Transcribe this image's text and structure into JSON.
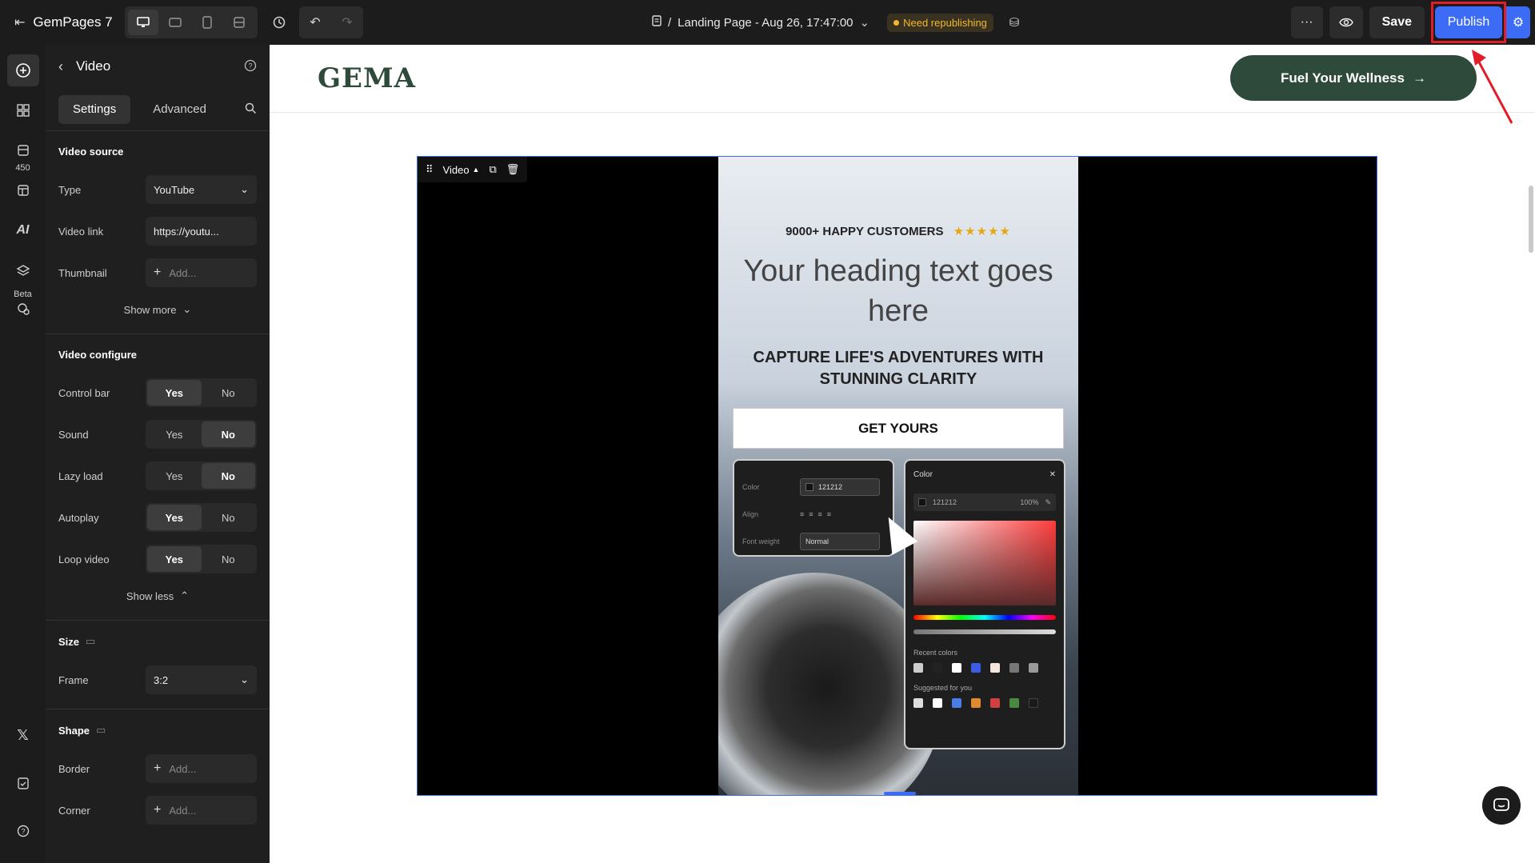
{
  "app": {
    "name": "GemPages 7"
  },
  "topbar": {
    "page_prefix": "/",
    "page_title": "Landing Page - Aug 26, 17:47:00",
    "status_badge": "Need republishing",
    "save_label": "Save",
    "publish_label": "Publish"
  },
  "rail": {
    "count_badge": "450",
    "beta_label": "Beta",
    "ai_label": "AI"
  },
  "panel": {
    "title": "Video",
    "tabs": [
      "Settings",
      "Advanced"
    ],
    "video_source": {
      "title": "Video source",
      "type_label": "Type",
      "type_value": "YouTube",
      "link_label": "Video link",
      "link_value": "https://youtu...",
      "thumb_label": "Thumbnail",
      "thumb_placeholder": "Add...",
      "show_more": "Show more"
    },
    "video_configure": {
      "title": "Video configure",
      "rows": [
        {
          "label": "Control bar",
          "selected": "Yes"
        },
        {
          "label": "Sound",
          "selected": "No"
        },
        {
          "label": "Lazy load",
          "selected": "No"
        },
        {
          "label": "Autoplay",
          "selected": "Yes"
        },
        {
          "label": "Loop video",
          "selected": "Yes"
        }
      ],
      "yes": "Yes",
      "no": "No",
      "show_less": "Show less"
    },
    "size": {
      "title": "Size",
      "frame_label": "Frame",
      "frame_value": "3:2"
    },
    "shape": {
      "title": "Shape",
      "border_label": "Border",
      "border_placeholder": "Add...",
      "corner_label": "Corner",
      "corner_placeholder": "Add..."
    }
  },
  "canvas": {
    "logo": "GEMA",
    "cta": "Fuel Your Wellness",
    "video_toolbar_label": "Video",
    "video": {
      "customers": "9000+ HAPPY CUSTOMERS",
      "stars": "★★★★★",
      "heading": "Your heading text goes here",
      "subheading": "CAPTURE LIFE'S ADVENTURES WITH STUNNING CLARITY",
      "button": "GET YOURS",
      "card1": {
        "color_label": "Color",
        "color_value": "121212",
        "align_label": "Align",
        "weight_label": "Font weight",
        "weight_value": "Normal"
      },
      "card2": {
        "title": "Color",
        "hex": "121212",
        "opacity": "100%",
        "recent": "Recent colors",
        "suggested": "Suggested for you"
      }
    }
  },
  "colors": {
    "brand_green": "#2d4a3a",
    "publish_blue": "#3c6cf6",
    "badge_yellow": "#f2b730",
    "highlight_red": "#e11d2a"
  }
}
